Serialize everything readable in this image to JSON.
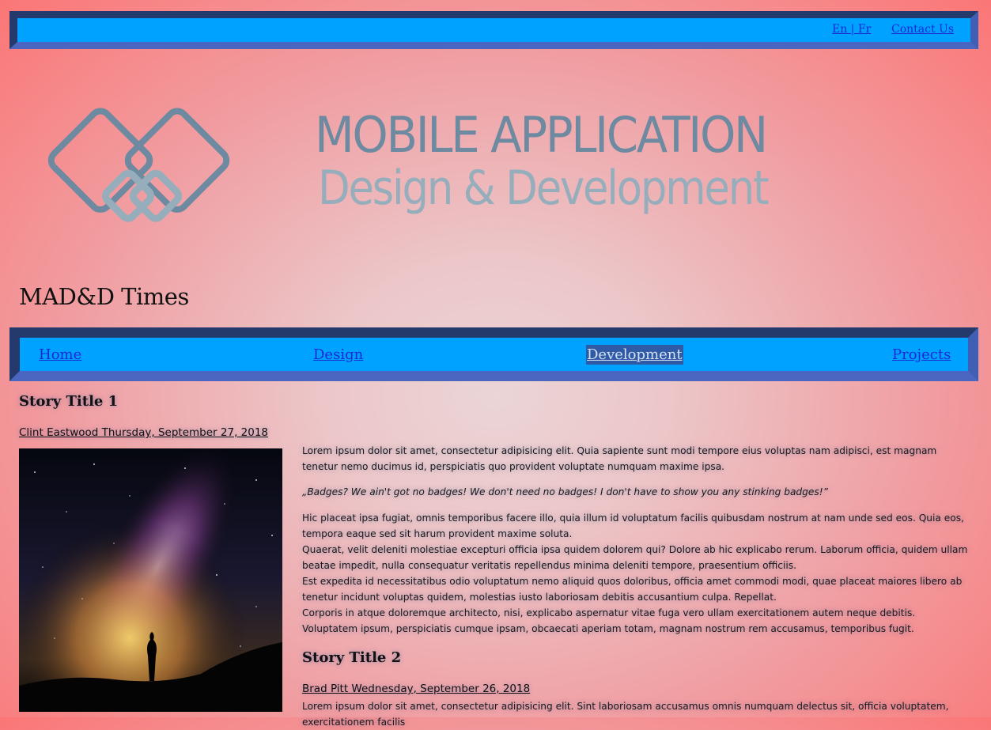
{
  "topbar": {
    "lang_label": "En | Fr",
    "contact_label": "Contact Us"
  },
  "brand": {
    "title": "MOBILE APPLICATION",
    "subtitle": "Design & Development"
  },
  "site": {
    "name": "MAD&D Times"
  },
  "nav": {
    "items": [
      {
        "label": "Home",
        "active": false
      },
      {
        "label": "Design",
        "active": false
      },
      {
        "label": "Development",
        "active": true
      },
      {
        "label": "Projects",
        "active": false
      }
    ]
  },
  "stories": [
    {
      "title": "Story Title 1",
      "byline": "Clint Eastwood Thursday, September 27, 2018",
      "intro": "Lorem ipsum dolor sit amet, consectetur adipisicing elit. Quia sapiente sunt modi tempore eius voluptas nam adipisci, est magnam tenetur nemo ducimus id, perspiciatis quo provident voluptate numquam maxime ipsa.",
      "quote": "„Badges? We ain't got no badges! We don't need no badges! I don't have to show you any stinking badges!”",
      "body": [
        "Hic placeat ipsa fugiat, omnis temporibus facere illo, quia illum id voluptatum facilis quibusdam nostrum at nam unde sed eos. Quia eos, tempora eaque sed sit harum provident maxime soluta.",
        "Quaerat, velit deleniti molestiae excepturi officia ipsa quidem dolorem qui? Dolore ab hic explicabo rerum. Laborum officia, quidem ullam beatae impedit, nulla consequatur veritatis repellendus minima deleniti tempore, praesentium officiis.",
        "Est expedita id necessitatibus odio voluptatum nemo aliquid quos doloribus, officia amet commodi modi, quae placeat maiores libero ab tenetur incidunt voluptas quidem, molestias iusto laboriosam debitis accusantium culpa. Repellat.",
        "Corporis in atque doloremque architecto, nisi, explicabo aspernatur vitae fuga vero ullam exercitationem autem neque debitis. Voluptatem ipsum, perspiciatis cumque ipsam, obcaecati aperiam totam, magnam nostrum rem accusamus, temporibus fugit."
      ]
    },
    {
      "title": "Story Title 2",
      "byline": "Brad Pitt Wednesday, September 26, 2018",
      "intro": "Lorem ipsum dolor sit amet, consectetur adipisicing elit. Sint laboriosam accusamus omnis numquam delectus sit, officia voluptatem, exercitationem facilis"
    }
  ],
  "colors": {
    "bar_blue": "#00a2ff",
    "bar_border_dark": "#253a6c",
    "link": "#1a2bd6",
    "active_bg": "#2f5aa6"
  },
  "icons": {
    "logo": "interlocking-diamonds-logo",
    "photo": "milky-way-stargazer-photo"
  }
}
